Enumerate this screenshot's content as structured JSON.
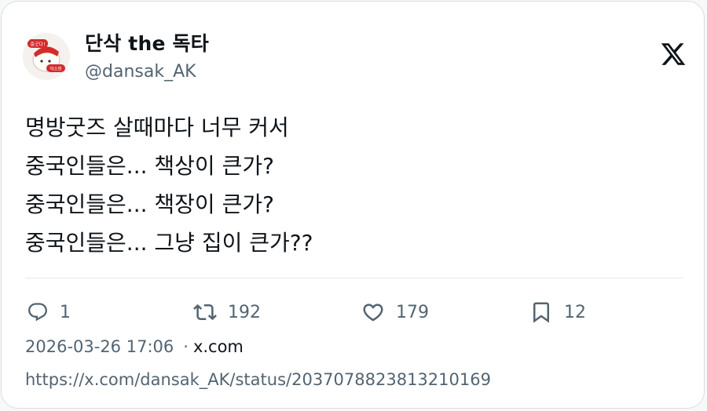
{
  "author": {
    "display_name": "단삭 the 독타",
    "handle": "@dansak_AK",
    "avatar_text_top": "중굿다!",
    "avatar_text_bottom": "덕소현"
  },
  "platform_logo": "x-logo-icon",
  "tweet": {
    "lines": [
      "명방굿즈 살때마다 너무 커서",
      "중국인들은... 책상이 큰가?",
      "중국인들은... 책장이 큰가?",
      "중국인들은... 그냥 집이 큰가??"
    ]
  },
  "actions": {
    "reply_count": "1",
    "retweet_count": "192",
    "like_count": "179",
    "bookmark_count": "12"
  },
  "meta": {
    "timestamp": "2026-03-26 17:06",
    "separator": "·",
    "site": "x.com"
  },
  "url": "https://x.com/dansak_AK/status/2037078823813210169",
  "colors": {
    "text": "#0f1419",
    "secondary": "#536471",
    "border": "#d9dde1",
    "avatar_accent": "#d52b2b"
  }
}
